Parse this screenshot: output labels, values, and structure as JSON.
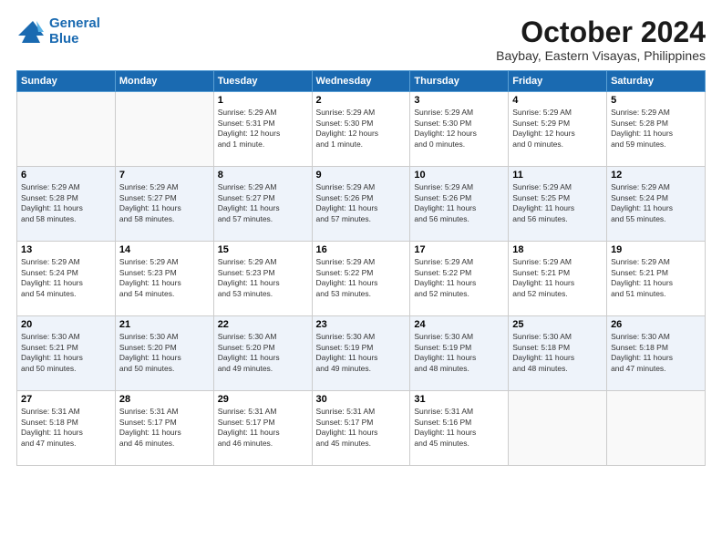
{
  "header": {
    "logo_line1": "General",
    "logo_line2": "Blue",
    "title": "October 2024",
    "subtitle": "Baybay, Eastern Visayas, Philippines"
  },
  "weekdays": [
    "Sunday",
    "Monday",
    "Tuesday",
    "Wednesday",
    "Thursday",
    "Friday",
    "Saturday"
  ],
  "weeks": [
    [
      {
        "day": "",
        "text": ""
      },
      {
        "day": "",
        "text": ""
      },
      {
        "day": "1",
        "text": "Sunrise: 5:29 AM\nSunset: 5:31 PM\nDaylight: 12 hours\nand 1 minute."
      },
      {
        "day": "2",
        "text": "Sunrise: 5:29 AM\nSunset: 5:30 PM\nDaylight: 12 hours\nand 1 minute."
      },
      {
        "day": "3",
        "text": "Sunrise: 5:29 AM\nSunset: 5:30 PM\nDaylight: 12 hours\nand 0 minutes."
      },
      {
        "day": "4",
        "text": "Sunrise: 5:29 AM\nSunset: 5:29 PM\nDaylight: 12 hours\nand 0 minutes."
      },
      {
        "day": "5",
        "text": "Sunrise: 5:29 AM\nSunset: 5:28 PM\nDaylight: 11 hours\nand 59 minutes."
      }
    ],
    [
      {
        "day": "6",
        "text": "Sunrise: 5:29 AM\nSunset: 5:28 PM\nDaylight: 11 hours\nand 58 minutes."
      },
      {
        "day": "7",
        "text": "Sunrise: 5:29 AM\nSunset: 5:27 PM\nDaylight: 11 hours\nand 58 minutes."
      },
      {
        "day": "8",
        "text": "Sunrise: 5:29 AM\nSunset: 5:27 PM\nDaylight: 11 hours\nand 57 minutes."
      },
      {
        "day": "9",
        "text": "Sunrise: 5:29 AM\nSunset: 5:26 PM\nDaylight: 11 hours\nand 57 minutes."
      },
      {
        "day": "10",
        "text": "Sunrise: 5:29 AM\nSunset: 5:26 PM\nDaylight: 11 hours\nand 56 minutes."
      },
      {
        "day": "11",
        "text": "Sunrise: 5:29 AM\nSunset: 5:25 PM\nDaylight: 11 hours\nand 56 minutes."
      },
      {
        "day": "12",
        "text": "Sunrise: 5:29 AM\nSunset: 5:24 PM\nDaylight: 11 hours\nand 55 minutes."
      }
    ],
    [
      {
        "day": "13",
        "text": "Sunrise: 5:29 AM\nSunset: 5:24 PM\nDaylight: 11 hours\nand 54 minutes."
      },
      {
        "day": "14",
        "text": "Sunrise: 5:29 AM\nSunset: 5:23 PM\nDaylight: 11 hours\nand 54 minutes."
      },
      {
        "day": "15",
        "text": "Sunrise: 5:29 AM\nSunset: 5:23 PM\nDaylight: 11 hours\nand 53 minutes."
      },
      {
        "day": "16",
        "text": "Sunrise: 5:29 AM\nSunset: 5:22 PM\nDaylight: 11 hours\nand 53 minutes."
      },
      {
        "day": "17",
        "text": "Sunrise: 5:29 AM\nSunset: 5:22 PM\nDaylight: 11 hours\nand 52 minutes."
      },
      {
        "day": "18",
        "text": "Sunrise: 5:29 AM\nSunset: 5:21 PM\nDaylight: 11 hours\nand 52 minutes."
      },
      {
        "day": "19",
        "text": "Sunrise: 5:29 AM\nSunset: 5:21 PM\nDaylight: 11 hours\nand 51 minutes."
      }
    ],
    [
      {
        "day": "20",
        "text": "Sunrise: 5:30 AM\nSunset: 5:21 PM\nDaylight: 11 hours\nand 50 minutes."
      },
      {
        "day": "21",
        "text": "Sunrise: 5:30 AM\nSunset: 5:20 PM\nDaylight: 11 hours\nand 50 minutes."
      },
      {
        "day": "22",
        "text": "Sunrise: 5:30 AM\nSunset: 5:20 PM\nDaylight: 11 hours\nand 49 minutes."
      },
      {
        "day": "23",
        "text": "Sunrise: 5:30 AM\nSunset: 5:19 PM\nDaylight: 11 hours\nand 49 minutes."
      },
      {
        "day": "24",
        "text": "Sunrise: 5:30 AM\nSunset: 5:19 PM\nDaylight: 11 hours\nand 48 minutes."
      },
      {
        "day": "25",
        "text": "Sunrise: 5:30 AM\nSunset: 5:18 PM\nDaylight: 11 hours\nand 48 minutes."
      },
      {
        "day": "26",
        "text": "Sunrise: 5:30 AM\nSunset: 5:18 PM\nDaylight: 11 hours\nand 47 minutes."
      }
    ],
    [
      {
        "day": "27",
        "text": "Sunrise: 5:31 AM\nSunset: 5:18 PM\nDaylight: 11 hours\nand 47 minutes."
      },
      {
        "day": "28",
        "text": "Sunrise: 5:31 AM\nSunset: 5:17 PM\nDaylight: 11 hours\nand 46 minutes."
      },
      {
        "day": "29",
        "text": "Sunrise: 5:31 AM\nSunset: 5:17 PM\nDaylight: 11 hours\nand 46 minutes."
      },
      {
        "day": "30",
        "text": "Sunrise: 5:31 AM\nSunset: 5:17 PM\nDaylight: 11 hours\nand 45 minutes."
      },
      {
        "day": "31",
        "text": "Sunrise: 5:31 AM\nSunset: 5:16 PM\nDaylight: 11 hours\nand 45 minutes."
      },
      {
        "day": "",
        "text": ""
      },
      {
        "day": "",
        "text": ""
      }
    ]
  ]
}
